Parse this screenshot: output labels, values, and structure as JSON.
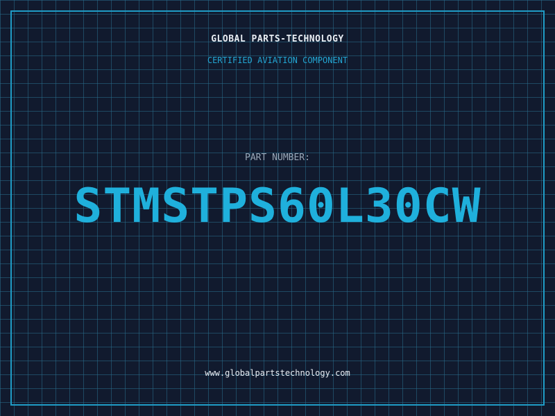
{
  "brand": {
    "name": "GLOBAL PARTS-TECHNOLOGY",
    "tagline": "CERTIFIED AVIATION COMPONENT"
  },
  "part": {
    "label": "PART NUMBER:",
    "number": "STMSTPS60L30CW"
  },
  "footer": {
    "website": "www.globalpartstechnology.com"
  },
  "colors": {
    "background": "#111a2e",
    "grid": "#286e8c",
    "accent": "#1fb0dc",
    "text": "#e8edf3",
    "muted": "#9aa8b8"
  }
}
